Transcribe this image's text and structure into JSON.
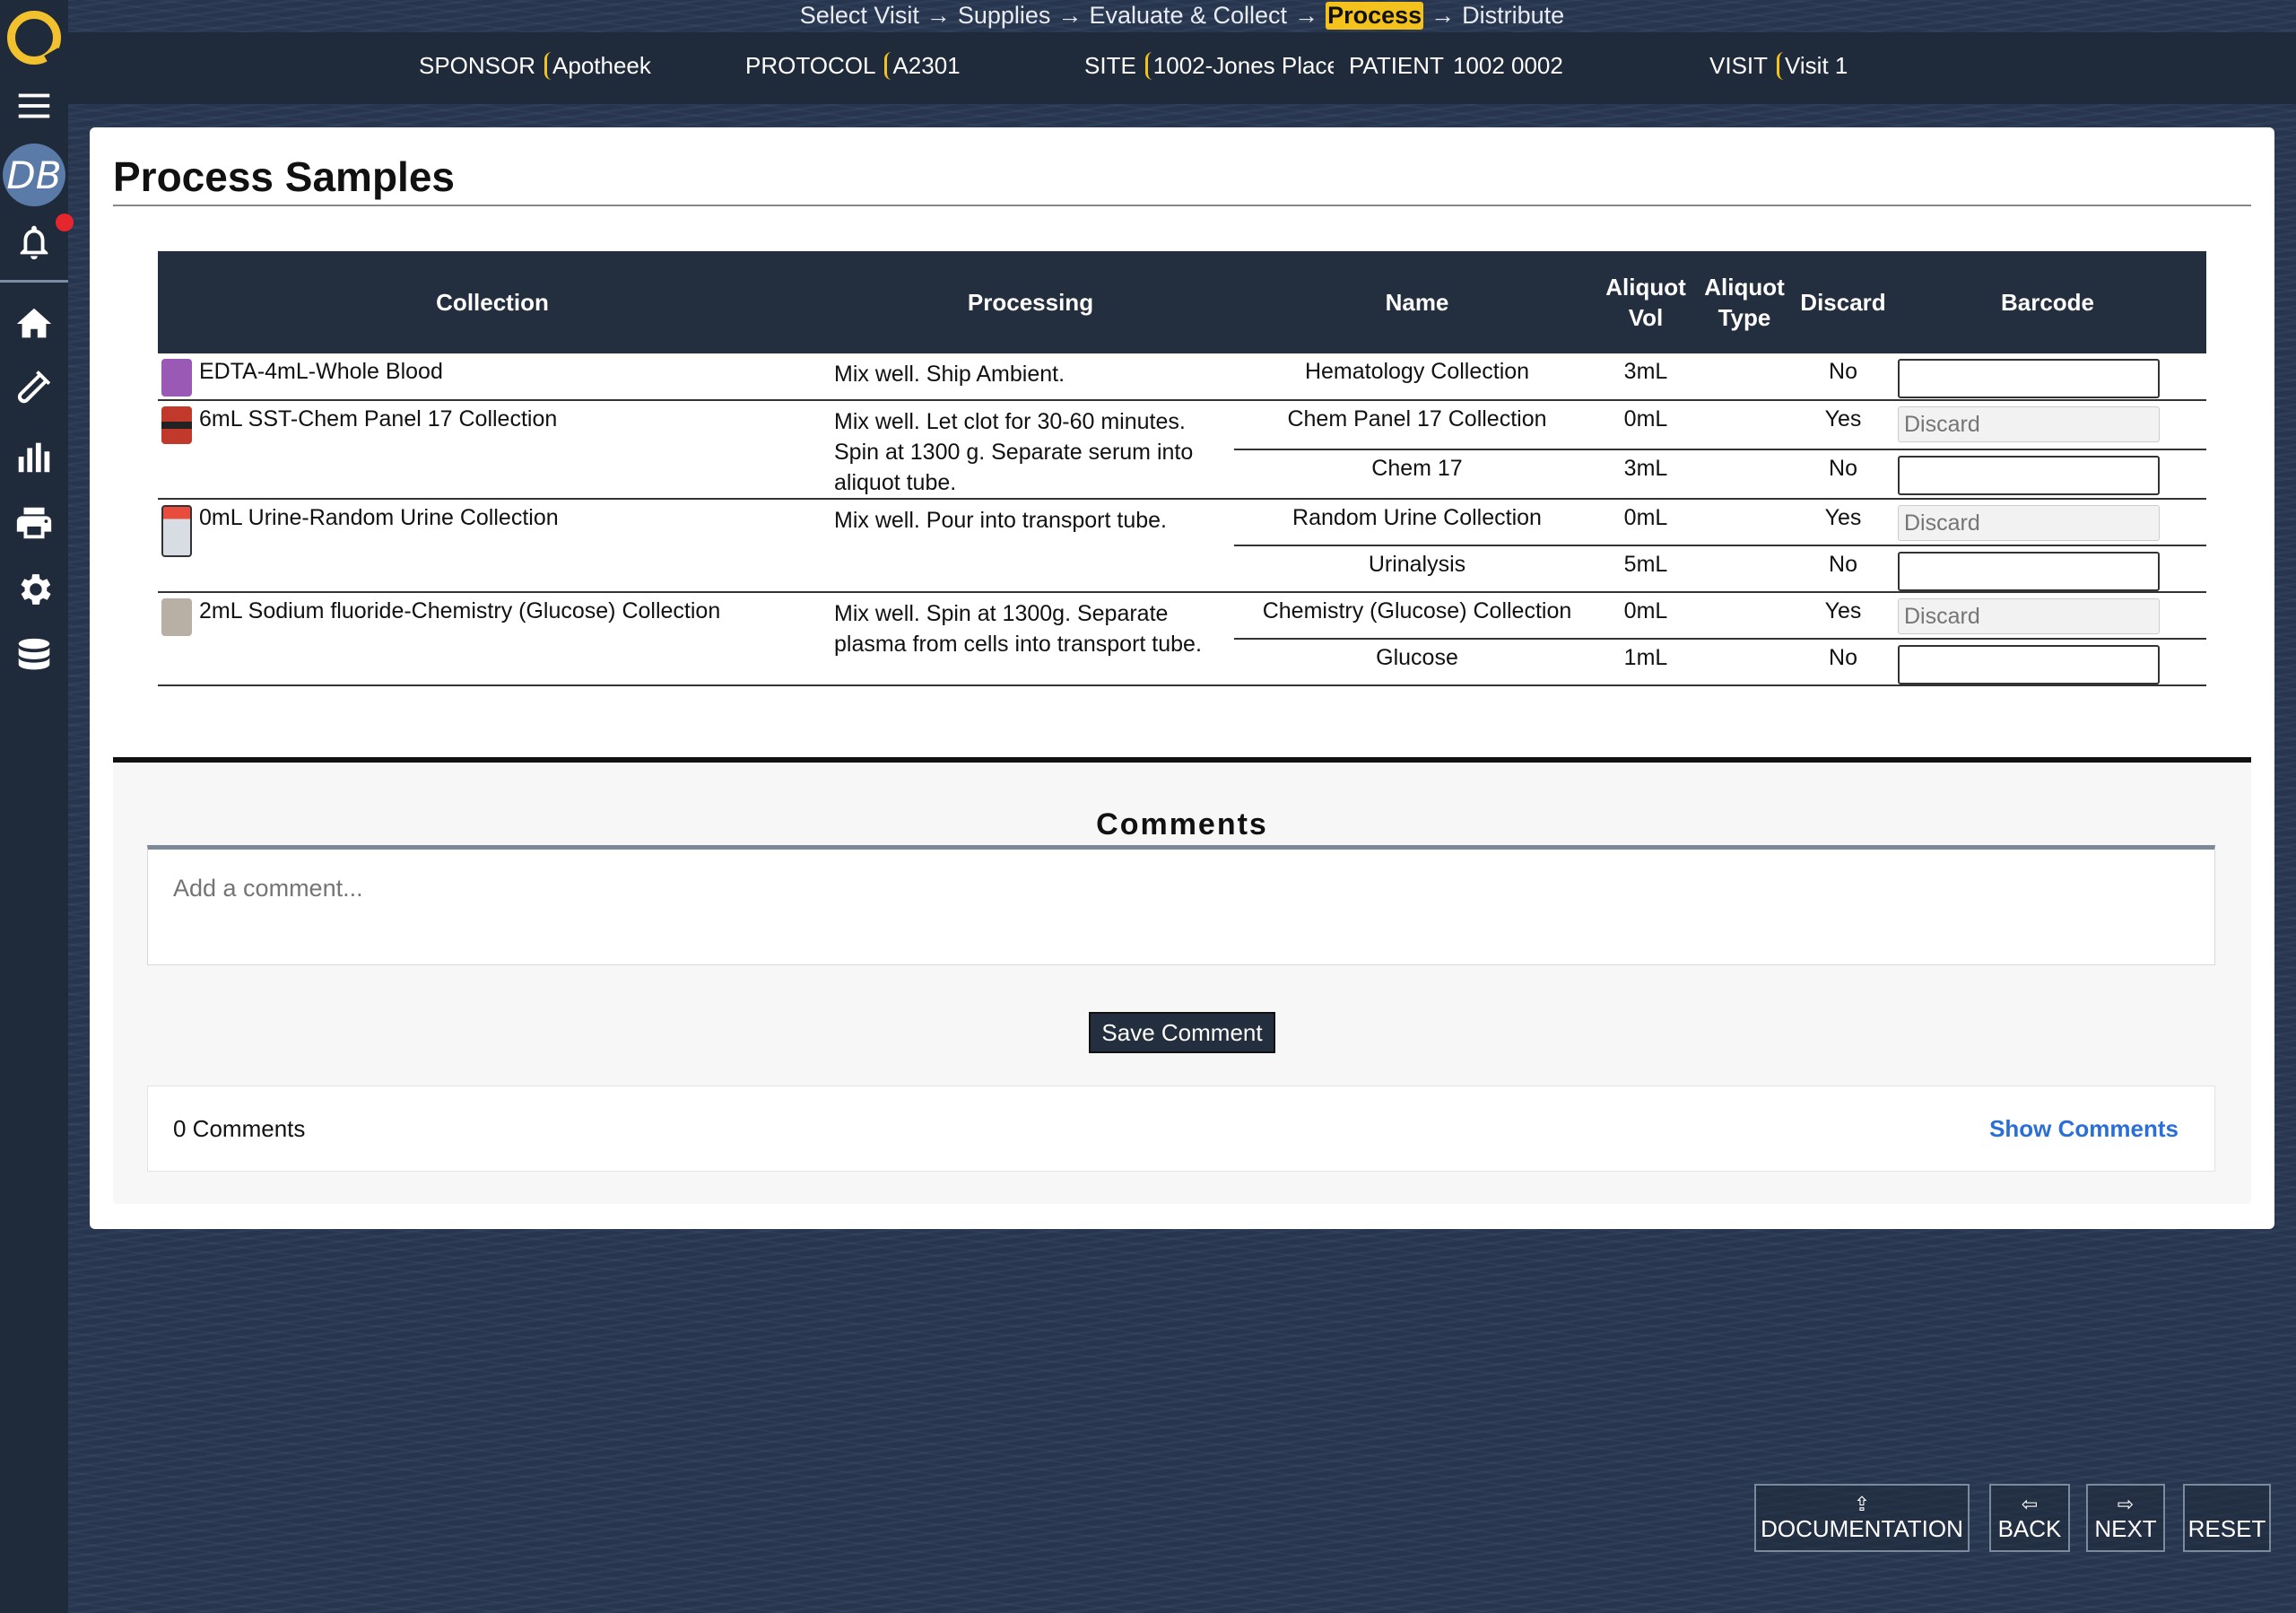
{
  "breadcrumbs": {
    "steps": [
      "Select Visit",
      "Supplies",
      "Evaluate & Collect",
      "Process",
      "Distribute"
    ],
    "arrow": "→"
  },
  "header": {
    "sponsor_label": "SPONSOR",
    "sponsor_value": "Apotheek",
    "protocol_label": "PROTOCOL",
    "protocol_value": "A2301",
    "site_label": "SITE",
    "site_value": "1002-Jones Place",
    "patient_label": "PATIENT",
    "patient_value": "1002 0002",
    "visit_label": "VISIT",
    "visit_value": "Visit 1"
  },
  "sidebar": {
    "avatar_initials": "DB"
  },
  "page": {
    "title": "Process Samples"
  },
  "table": {
    "headers": {
      "collection": "Collection",
      "processing": "Processing",
      "name": "Name",
      "aliquot_vol": "Aliquot Vol",
      "aliquot_type": "Aliquot Type",
      "discard": "Discard",
      "barcode": "Barcode"
    },
    "rows": [
      {
        "collection": "EDTA-4mL-Whole Blood",
        "processing": "Mix well. Ship Ambient.",
        "tube_color": "#9b59b6",
        "name": "Hematology Collection",
        "vol": "3mL",
        "discard": "No",
        "barcode": ""
      },
      {
        "collection": "6mL SST-Chem Panel 17 Collection",
        "processing": "Mix well. Let clot for 30-60 minutes. Spin at 1300 g. Separate serum into aliquot tube.",
        "tube_color": "#c0392b",
        "name": "Chem Panel 17 Collection",
        "vol": "0mL",
        "discard": "Yes",
        "barcode_placeholder": "Discard"
      },
      {
        "name": "Chem 17",
        "vol": "3mL",
        "discard": "No",
        "barcode": ""
      },
      {
        "collection": "0mL Urine-Random Urine Collection",
        "processing": "Mix well. Pour into transport tube.",
        "tube_color": "#e74c3c",
        "name": "Random Urine Collection",
        "vol": "0mL",
        "discard": "Yes",
        "barcode_placeholder": "Discard"
      },
      {
        "name": "Urinalysis",
        "vol": "5mL",
        "discard": "No",
        "barcode": ""
      },
      {
        "collection": "2mL Sodium fluoride-Chemistry (Glucose) Collection",
        "processing": "Mix well. Spin at 1300g. Separate plasma from cells into transport tube.",
        "tube_color": "#b8b0a4",
        "name": "Chemistry (Glucose) Collection",
        "vol": "0mL",
        "discard": "Yes",
        "barcode_placeholder": "Discard"
      },
      {
        "name": "Glucose",
        "vol": "1mL",
        "discard": "No",
        "barcode": ""
      }
    ]
  },
  "comments": {
    "title": "Comments",
    "placeholder": "Add a comment...",
    "save_label": "Save Comment",
    "count_label": "0 Comments",
    "show_label": "Show Comments"
  },
  "nav": {
    "documentation": "DOCUMENTATION",
    "back": "BACK",
    "next": "NEXT",
    "reset": "RESET"
  },
  "colors": {
    "accent": "#f4c21d",
    "dark": "#1f2a3a",
    "link": "#2a6fd6",
    "alert": "#e6262d"
  }
}
